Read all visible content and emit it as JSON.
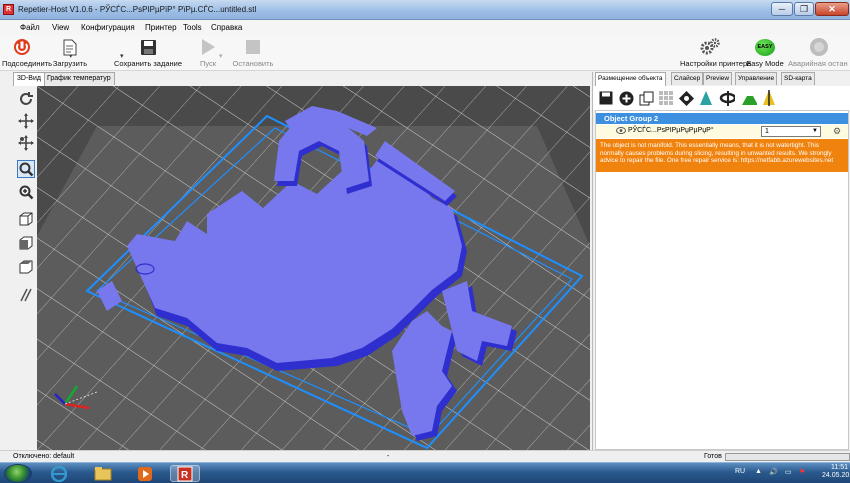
{
  "window": {
    "title": "Repetier-Host V1.0.6 - РЎСЃС...РѕРІРµРїР° РїРµ.СЃС...untitled.stl",
    "min": "─",
    "max": "❐",
    "close": "✕",
    "app_icon": "R"
  },
  "menu": [
    "Файл",
    "View",
    "Конфигурация",
    "Принтер",
    "Tools",
    "Справка"
  ],
  "toolbar": {
    "connect": "Подсоединить",
    "load": "Загрузить",
    "save_job": "Сохранить задание",
    "start": "Пуск",
    "stop": "Остановить",
    "printer_settings": "Настройки принтера",
    "easy_mode": "Easy Mode",
    "emergency": "Аварийная остан",
    "easy_badge": "EASY"
  },
  "left_tabs": [
    "3D-Вид",
    "График температур"
  ],
  "right_tabs": [
    "Размещение объекта",
    "Слайсер",
    "Preview",
    "Управление",
    "SD-карта"
  ],
  "object_panel": {
    "group": "Object Group 2",
    "object_name": "РЎСЃС...РѕРІРµРџРµРџР°",
    "copies": "1",
    "warning": "The object is not manifold. This essentially means, that it is not watertight. This normally causes problems during slicing, resulting in unwanted results. We strongly advice to repair the file. One free repair service is: https://netfabb.azurewebsites.net"
  },
  "status": {
    "connection": "Отключено: default",
    "center": "-",
    "ready": "Готов"
  },
  "taskbar": {
    "lang": "RU",
    "time": "11:51",
    "date": "24.05.2018"
  },
  "colors": {
    "viewport_bg": "#4a4a4a",
    "model": "#7777ee",
    "model_side": "#2f2fcf",
    "build_box": "#1e8fff",
    "warning_bg": "#f0820e",
    "group_bg": "#3d8fe0"
  }
}
